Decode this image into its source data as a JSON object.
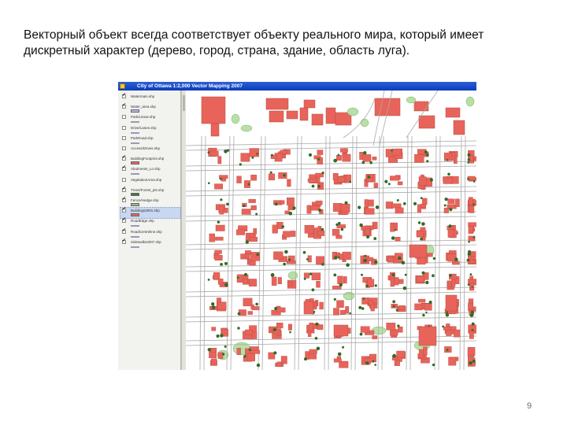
{
  "caption": {
    "line1": "Векторный объект всегда соответствует объекту реального мира, который имеет",
    "line2": "дискретный характер (дерево, город, страна, здание, область луга)."
  },
  "window": {
    "title": "City of Ottawa 1:2,000 Vector Mapping 2007"
  },
  "toc": {
    "layers": [
      {
        "name": "Watermain.shp",
        "checked": true,
        "symbol": "none"
      },
      {
        "name": "Water_area.shp",
        "checked": true,
        "symbol": "fill"
      },
      {
        "name": "Park/Linear.shp",
        "checked": false,
        "symbol": "line"
      },
      {
        "name": "Drive/Lanes.shp",
        "checked": false,
        "symbol": "line"
      },
      {
        "name": "ParkRoad.shp",
        "checked": false,
        "symbol": "line"
      },
      {
        "name": "Access/Drives.shp",
        "checked": false,
        "symbol": "none"
      },
      {
        "name": "BuildingFootprint.shp",
        "checked": true,
        "symbol": "fill"
      },
      {
        "name": "Abutments_Ln.shp",
        "checked": true,
        "symbol": "line"
      },
      {
        "name": "VegetationArea.shp",
        "checked": false,
        "symbol": "none"
      },
      {
        "name": "Trees/Forest_pts.shp",
        "checked": true,
        "symbol": "fill"
      },
      {
        "name": "Fence/Hedge.shp",
        "checked": true,
        "symbol": "fill"
      },
      {
        "name": "Buildings2001.shp",
        "checked": true,
        "symbol": "fill",
        "selected": true
      },
      {
        "name": "RoadEdge.shp",
        "checked": true,
        "symbol": "line"
      },
      {
        "name": "RoadCentreline.shp",
        "checked": true,
        "symbol": "line"
      },
      {
        "name": "Sidewalks2007.shp",
        "checked": true,
        "symbol": "line"
      }
    ]
  },
  "map": {
    "colors": {
      "background": "#ffffff",
      "road_edge": "#aaaaaa",
      "building": "#e8645a",
      "building_stroke": "#b34a42",
      "vegetation": "#b8e0a6",
      "vegetation_stroke": "#7cae6a",
      "tree": "#2f6b26"
    }
  },
  "page_number": "9"
}
